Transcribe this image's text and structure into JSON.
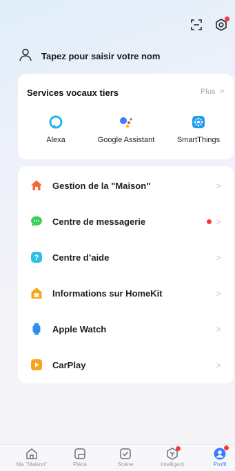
{
  "profile": {
    "name_prompt": "Tapez pour saisir votre nom"
  },
  "voice_services": {
    "title": "Services vocaux tiers",
    "more": "Plus",
    "items": [
      {
        "label": "Alexa",
        "icon": "alexa-icon"
      },
      {
        "label": "Google Assistant",
        "icon": "google-assistant-icon"
      },
      {
        "label": "SmartThings",
        "icon": "smartthings-icon"
      }
    ]
  },
  "menu": {
    "items": [
      {
        "label": "Gestion de la \"Maison\"",
        "icon": "home-icon",
        "color": "#f26a3c"
      },
      {
        "label": "Centre de messagerie",
        "icon": "message-icon",
        "color": "#3ccf5a"
      },
      {
        "label": "Centre d’aide",
        "icon": "help-icon",
        "color": "#2cc1e6"
      },
      {
        "label": "Informations sur HomeKit",
        "icon": "homekit-icon",
        "color": "#f7a51b"
      },
      {
        "label": "Apple Watch",
        "icon": "watch-icon",
        "color": "#2f8cf2"
      },
      {
        "label": "CarPlay",
        "icon": "carplay-icon",
        "color": "#f7a51b"
      }
    ]
  },
  "tabs": [
    {
      "label": "Ma \"Maison\"",
      "icon": "home-tab-icon"
    },
    {
      "label": "Pièce",
      "icon": "room-tab-icon"
    },
    {
      "label": "Scène",
      "icon": "scene-tab-icon"
    },
    {
      "label": "Intelligent",
      "icon": "smart-tab-icon"
    },
    {
      "label": "Profil",
      "icon": "profile-tab-icon"
    }
  ],
  "colors": {
    "accent": "#3d7bff",
    "notification": "#f23a3a"
  }
}
